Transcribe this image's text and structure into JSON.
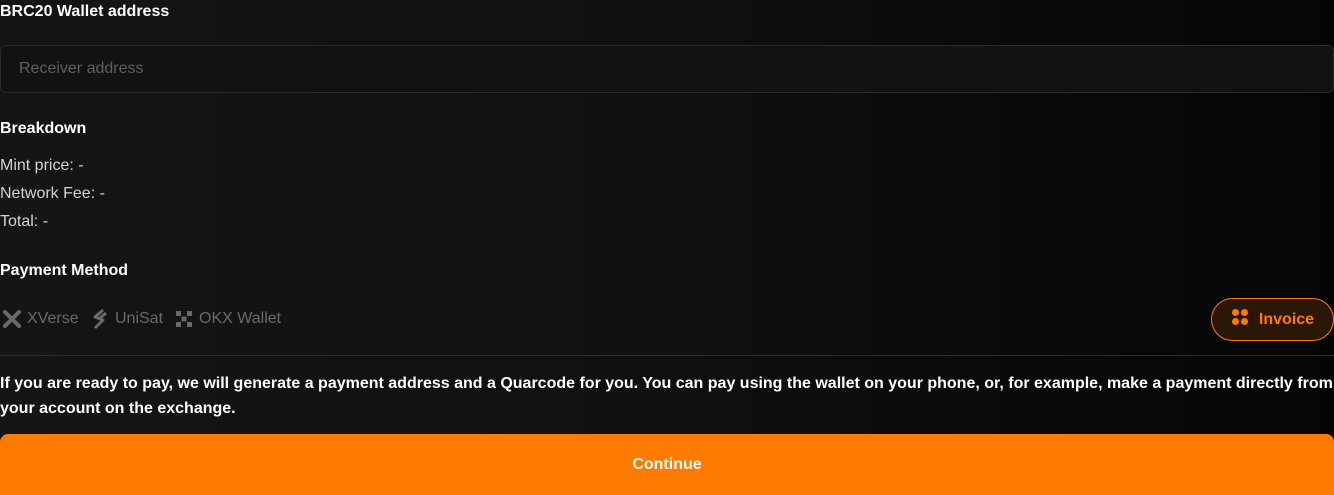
{
  "wallet": {
    "title": "BRC20 Wallet address",
    "placeholder": "Receiver address"
  },
  "breakdown": {
    "heading": "Breakdown",
    "mint_price": "Mint price: -",
    "network_fee": "Network Fee: -",
    "total": "Total: -"
  },
  "payment": {
    "heading": "Payment Method",
    "options": [
      {
        "label": "XVerse",
        "icon": "xverse-icon"
      },
      {
        "label": "UniSat",
        "icon": "unisat-icon"
      },
      {
        "label": "OKX Wallet",
        "icon": "okx-icon"
      }
    ],
    "invoice_label": "Invoice",
    "invoice_icon": "four-dots-icon"
  },
  "notice": "If you are ready to pay, we will generate a payment address and a Quarcode for you. You can pay using the wallet on your phone, or, for example, make a payment directly from your account on the exchange.",
  "continue_label": "Continue",
  "colors": {
    "accent": "#ff7a00",
    "background": "#101010",
    "muted": "#6a6a6a"
  }
}
